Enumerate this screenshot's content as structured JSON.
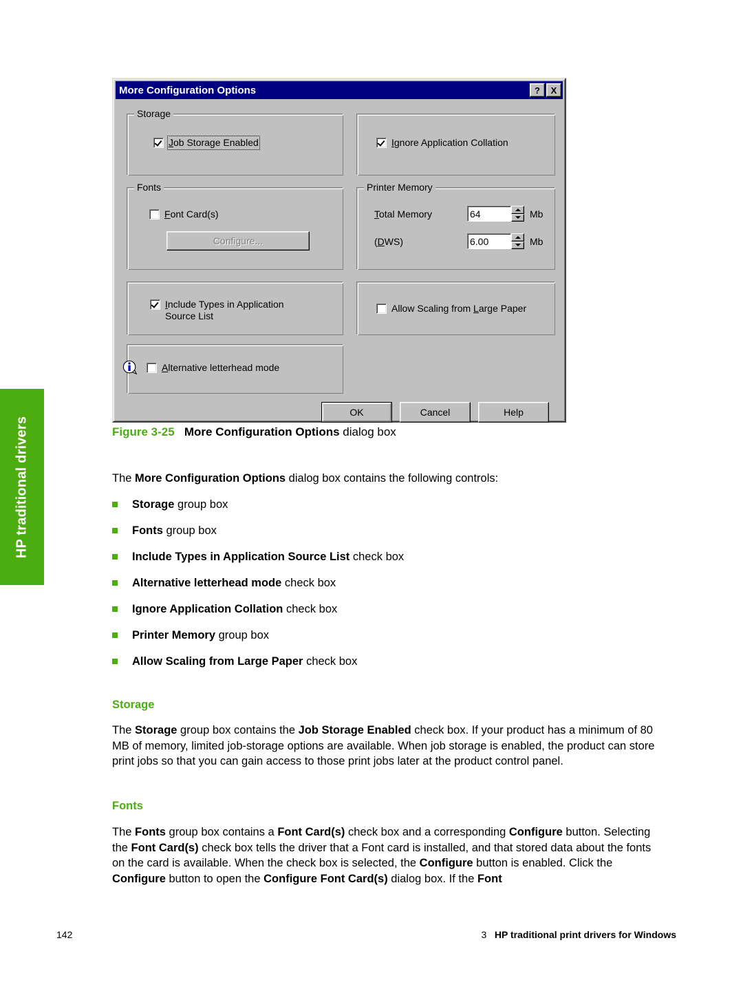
{
  "side_tab": {
    "label": "HP traditional drivers",
    "color": "#4cad11"
  },
  "dialog": {
    "title": "More Configuration Options",
    "titlebar_color": "#000080",
    "help_button": "?",
    "close_button": "X",
    "storage_group": {
      "title": "Storage",
      "job_storage_enabled": {
        "label": "Job Storage Enabled",
        "checked": true,
        "focused": true
      }
    },
    "collation_group": {
      "ignore_application_collation": {
        "label": "Ignore Application Collation",
        "checked": true
      }
    },
    "fonts_group": {
      "title": "Fonts",
      "font_cards": {
        "label": "Font Card(s)",
        "checked": false
      },
      "configure_button": {
        "label": "Configure...",
        "enabled": false
      }
    },
    "printer_memory_group": {
      "title": "Printer Memory",
      "total_memory": {
        "label": "Total Memory",
        "value": "64",
        "unit": "Mb"
      },
      "dws": {
        "label": "(DWS)",
        "value": "6.00",
        "unit": "Mb"
      }
    },
    "include_types_group": {
      "include_types": {
        "label": "Include Types in Application\nSource List",
        "checked": true
      }
    },
    "allow_scaling_group": {
      "allow_scaling": {
        "label": "Allow Scaling from Large Paper",
        "checked": false
      }
    },
    "letterhead_group": {
      "info_icon": "info-icon",
      "alternative_letterhead": {
        "label": "Alternative letterhead mode",
        "checked": false
      }
    },
    "buttons": {
      "ok": "OK",
      "cancel": "Cancel",
      "help": "Help"
    }
  },
  "figure": {
    "number": "Figure 3-25",
    "bold_title": "More Configuration Options",
    "suffix": " dialog box"
  },
  "content": {
    "intro_pre": "The ",
    "intro_bold": "More Configuration Options",
    "intro_post": " dialog box contains the following controls:",
    "bullets": [
      {
        "bold": "Storage",
        "rest": " group box"
      },
      {
        "bold": "Fonts",
        "rest": " group box"
      },
      {
        "bold": "Include Types in Application Source List",
        "rest": " check box"
      },
      {
        "bold": "Alternative letterhead mode",
        "rest": " check box"
      },
      {
        "bold": "Ignore Application Collation",
        "rest": " check box"
      },
      {
        "bold": "Printer Memory",
        "rest": " group box"
      },
      {
        "bold": "Allow Scaling from Large Paper",
        "rest": " check box"
      }
    ],
    "storage_heading": "Storage",
    "storage_paragraph_html": "The <b>Storage</b> group box contains the <b>Job Storage Enabled</b> check box. If your product has a minimum of 80 MB of memory, limited job-storage options are available. When job storage is enabled, the product can store print jobs so that you can gain access to those print jobs later at the product control panel.",
    "fonts_heading": "Fonts",
    "fonts_paragraph_html": "The <b>Fonts</b> group box contains a <b>Font Card(s)</b> check box and a corresponding <b>Configure</b> button. Selecting the <b>Font Card(s)</b> check box tells the driver that a Font card is installed, and that stored data about the fonts on the card is available. When the check box is selected, the <b>Configure</b> button is enabled. Click the <b>Configure</b> button to open the <b>Configure Font Card(s)</b> dialog box. If the <b>Font</b>",
    "heading_color": "#4cad11"
  },
  "footer": {
    "page_number": "142",
    "chapter_number": "3",
    "chapter_title": "HP traditional print drivers for Windows"
  }
}
